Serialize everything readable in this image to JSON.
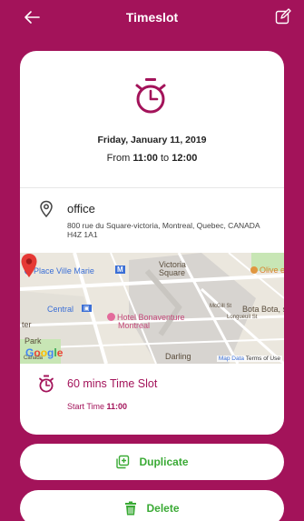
{
  "header": {
    "title": "Timeslot",
    "back_icon": "arrow-left-icon",
    "edit_icon": "edit-icon"
  },
  "event": {
    "date": "Friday, January 11, 2019",
    "time_prefix": "From ",
    "start": "11:00",
    "time_mid": " to ",
    "end": "12:00"
  },
  "location": {
    "name": "office",
    "address": "800 rue du Square-victoria, Montreal, Quebec, CANADA H4Z 1A1"
  },
  "map": {
    "labels": {
      "place_ville_marie": "Place Ville Marie",
      "metro": "M",
      "victoria": "Victoria",
      "square": "Square",
      "olive": "Olive et",
      "central": "Central",
      "hotel1": "Hotel Bonaventure",
      "hotel2": "Montreal",
      "bota": "Bota Bota, spa",
      "park": "Park",
      "darling": "Darling",
      "mcgill": "McGill St",
      "longueuil": "Longueuil St",
      "ter": "ter",
      "canada": "Canada"
    },
    "google": "Google",
    "map_data": "Map Data",
    "terms": "Terms of Use"
  },
  "slot": {
    "title": "60 mins Time Slot",
    "start_label": "Start Time ",
    "start_value": "11:00"
  },
  "actions": {
    "duplicate": "Duplicate",
    "delete": "Delete"
  },
  "colors": {
    "primary": "#a3135a",
    "action": "#3aaa35",
    "map_pin": "#e53935"
  }
}
